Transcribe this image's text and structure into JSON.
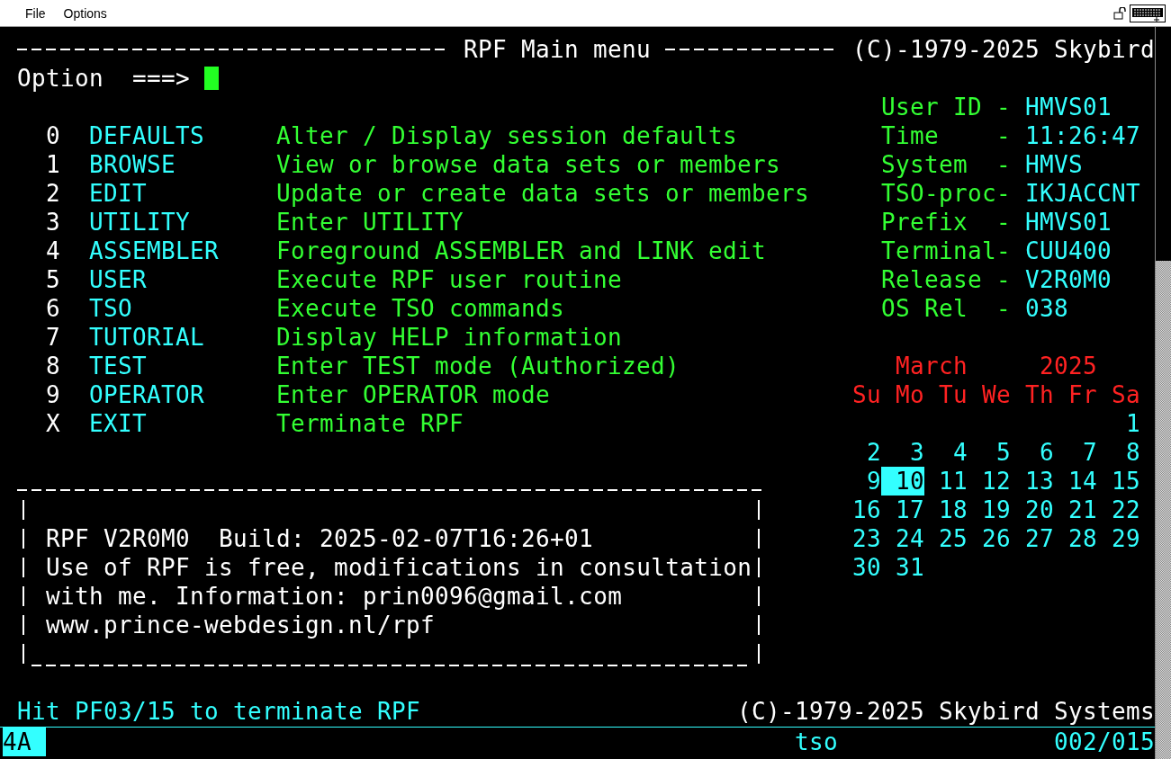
{
  "menu_bar": {
    "items": [
      "File",
      "Options"
    ]
  },
  "header": {
    "title": "RPF Main menu",
    "copyright": "(C)-1979-2025 Skybird"
  },
  "option": {
    "label": "Option",
    "prompt": "===>"
  },
  "menu": [
    {
      "key": "0",
      "name": "DEFAULTS",
      "description": "Alter / Display session defaults"
    },
    {
      "key": "1",
      "name": "BROWSE",
      "description": "View or browse data sets or members"
    },
    {
      "key": "2",
      "name": "EDIT",
      "description": "Update or create data sets or members"
    },
    {
      "key": "3",
      "name": "UTILITY",
      "description": "Enter UTILITY"
    },
    {
      "key": "4",
      "name": "ASSEMBLER",
      "description": "Foreground ASSEMBLER and LINK edit"
    },
    {
      "key": "5",
      "name": "USER",
      "description": "Execute RPF user routine"
    },
    {
      "key": "6",
      "name": "TSO",
      "description": "Execute TSO commands"
    },
    {
      "key": "7",
      "name": "TUTORIAL",
      "description": "Display HELP information"
    },
    {
      "key": "8",
      "name": "TEST",
      "description": "Enter TEST mode (Authorized)"
    },
    {
      "key": "9",
      "name": "OPERATOR",
      "description": "Enter OPERATOR mode"
    },
    {
      "key": "X",
      "name": "EXIT",
      "description": "Terminate RPF"
    }
  ],
  "system_info": [
    {
      "label": "User ID -",
      "value": "HMVS01"
    },
    {
      "label": "Time    -",
      "value": "11:26:47"
    },
    {
      "label": "System  -",
      "value": "HMVS"
    },
    {
      "label": "TSO-proc-",
      "value": "IKJACCNT"
    },
    {
      "label": "Prefix  -",
      "value": "HMVS01"
    },
    {
      "label": "Terminal-",
      "value": "CUU400"
    },
    {
      "label": "Release -",
      "value": "V2R0M0"
    },
    {
      "label": "OS Rel  -",
      "value": "038"
    }
  ],
  "calendar": {
    "month": "March",
    "year": "2025",
    "weekdays": [
      "Su",
      "Mo",
      "Tu",
      "We",
      "Th",
      "Fr",
      "Sa"
    ],
    "weeks": [
      [
        {
          "day": "1",
          "selected": false
        }
      ],
      [
        {
          "day": "2",
          "selected": false
        },
        {
          "day": "3",
          "selected": false
        },
        {
          "day": "4",
          "selected": false
        },
        {
          "day": "5",
          "selected": false
        },
        {
          "day": "6",
          "selected": false
        },
        {
          "day": "7",
          "selected": false
        },
        {
          "day": "8",
          "selected": false
        }
      ],
      [
        {
          "day": "9",
          "selected": false
        },
        {
          "day": "10",
          "selected": true
        },
        {
          "day": "11",
          "selected": false
        },
        {
          "day": "12",
          "selected": false
        },
        {
          "day": "13",
          "selected": false
        },
        {
          "day": "14",
          "selected": false
        },
        {
          "day": "15",
          "selected": false
        }
      ],
      [
        {
          "day": "16",
          "selected": false
        },
        {
          "day": "17",
          "selected": false
        },
        {
          "day": "18",
          "selected": false
        },
        {
          "day": "19",
          "selected": false
        },
        {
          "day": "20",
          "selected": false
        },
        {
          "day": "21",
          "selected": false
        },
        {
          "day": "22",
          "selected": false
        }
      ],
      [
        {
          "day": "23",
          "selected": false
        },
        {
          "day": "24",
          "selected": false
        },
        {
          "day": "25",
          "selected": false
        },
        {
          "day": "26",
          "selected": false
        },
        {
          "day": "27",
          "selected": false
        },
        {
          "day": "28",
          "selected": false
        },
        {
          "day": "29",
          "selected": false
        }
      ],
      [
        {
          "day": "30",
          "selected": false
        },
        {
          "day": "31",
          "selected": false
        }
      ]
    ]
  },
  "info_box": {
    "lines": [
      "RPF V2R0M0  Build: 2025-02-07T16:26+01",
      "Use of RPF is free, modifications in consultation",
      "with me. Information: prin0096@gmail.com",
      "www.prince-webdesign.nl/rpf"
    ]
  },
  "footer": {
    "hint": "Hit PF03/15 to terminate RPF",
    "copyright": "(C)-1979-2025 Skybird Systems"
  },
  "status_bar": {
    "indicator": "4A",
    "session": "tso",
    "position": "002/015"
  }
}
